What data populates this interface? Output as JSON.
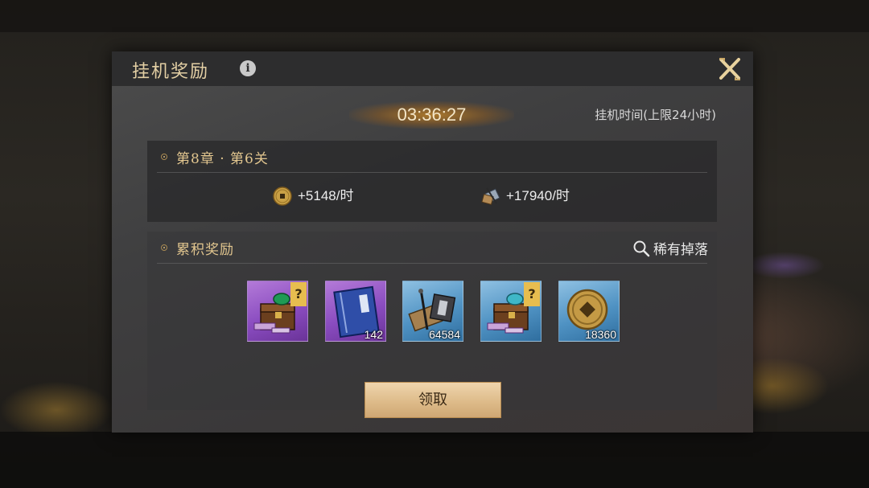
{
  "dialog": {
    "title": "挂机奖励",
    "info_icon": "info-icon",
    "close_icon": "close-icon"
  },
  "idle": {
    "timer": "03:36:27",
    "time_label": "挂机时间(上限24小时)"
  },
  "stage": {
    "title": "第8章 · 第6关",
    "rates": [
      {
        "icon": "copper-coin-icon",
        "text": "+5148/时"
      },
      {
        "icon": "experience-scroll-icon",
        "text": "+17940/时"
      }
    ]
  },
  "rewards": {
    "title": "累积奖励",
    "rare_drop_label": "稀有掉落",
    "items": [
      {
        "icon": "treasure-chest-icon",
        "rarity": "purple",
        "badge": "?",
        "count": ""
      },
      {
        "icon": "blue-book-icon",
        "rarity": "purple",
        "badge": "",
        "count": "142"
      },
      {
        "icon": "brush-scroll-icon",
        "rarity": "blue",
        "badge": "",
        "count": "64584"
      },
      {
        "icon": "treasure-chest-icon",
        "rarity": "blue",
        "badge": "?",
        "count": ""
      },
      {
        "icon": "copper-coin-icon",
        "rarity": "blue",
        "badge": "",
        "count": "18360"
      }
    ]
  },
  "actions": {
    "claim_label": "领取"
  },
  "colors": {
    "title_gold": "#e3cfa4",
    "section_gold": "#e2c68f",
    "purple_rarity": "#8a4cc0",
    "blue_rarity": "#4f92c3",
    "button": "#dcb987"
  }
}
